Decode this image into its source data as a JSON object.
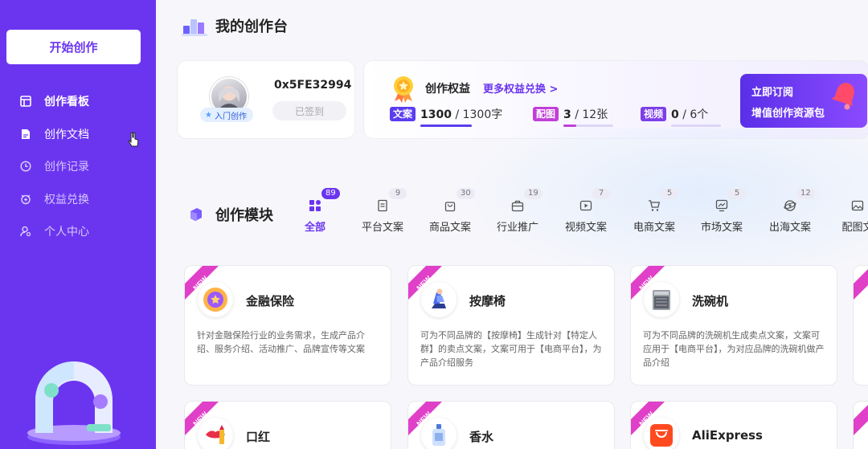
{
  "sidebar": {
    "start_button": "开始创作",
    "items": [
      {
        "label": "创作看板",
        "icon": "dashboard-icon",
        "active": true
      },
      {
        "label": "创作文档",
        "icon": "document-icon",
        "active": false
      },
      {
        "label": "创作记录",
        "icon": "clock-icon",
        "active": false
      },
      {
        "label": "权益兑换",
        "icon": "exchange-icon",
        "active": false
      },
      {
        "label": "个人中心",
        "icon": "user-icon",
        "active": false
      }
    ]
  },
  "header": {
    "title": "我的创作台"
  },
  "profile": {
    "user_id": "0x5FE32994",
    "level": "入门创作",
    "checkin": "已签到"
  },
  "benefits": {
    "title": "创作权益",
    "more": "更多权益兑换 >",
    "quotas": [
      {
        "tag": "文案",
        "used": "1300",
        "total": "/ 1300字",
        "fraction": 1.0
      },
      {
        "tag": "配图",
        "used": "3",
        "total": "/ 12张",
        "fraction": 0.25
      },
      {
        "tag": "视频",
        "used": "0",
        "total": "/ 6个",
        "fraction": 0.0
      }
    ],
    "subscribe_line1": "立即订阅",
    "subscribe_line2": "增值创作资源包"
  },
  "modules": {
    "title": "创作模块",
    "tabs": [
      {
        "label": "全部",
        "count": "89",
        "icon": "grid-icon",
        "active": true
      },
      {
        "label": "平台文案",
        "count": "9",
        "icon": "doc-icon"
      },
      {
        "label": "商品文案",
        "count": "30",
        "icon": "bag-icon"
      },
      {
        "label": "行业推广",
        "count": "19",
        "icon": "briefcase-icon"
      },
      {
        "label": "视频文案",
        "count": "7",
        "icon": "video-icon"
      },
      {
        "label": "电商文案",
        "count": "5",
        "icon": "cart-icon"
      },
      {
        "label": "市场文案",
        "count": "5",
        "icon": "chart-icon"
      },
      {
        "label": "出海文案",
        "count": "12",
        "icon": "globe-icon"
      },
      {
        "label": "配图文",
        "count": "",
        "icon": "image-icon"
      }
    ],
    "cards": [
      {
        "badge": "NEW",
        "title": "金融保险",
        "desc": "针对金融保险行业的业务需求，生成产品介绍、服务介绍、活动推广、品牌宣传等文案"
      },
      {
        "badge": "NEW",
        "title": "按摩椅",
        "desc": "可为不同品牌的【按摩椅】生成针对【特定人群】的卖点文案，文案可用于【电商平台】，为产品介绍服务"
      },
      {
        "badge": "NEW",
        "title": "洗碗机",
        "desc": "可为不同品牌的洗碗机生成卖点文案，文案可应用于【电商平台】，为对应品牌的洗碗机做产品介绍"
      },
      {
        "badge": "NEW",
        "title": "口红",
        "desc": ""
      },
      {
        "badge": "NEW",
        "title": "香水",
        "desc": ""
      },
      {
        "badge": "NEW",
        "title": "AliExpress",
        "desc": ""
      }
    ]
  },
  "colors": {
    "accent": "#6b35f0",
    "tag_copy": "#5a3df0",
    "tag_image": "#c13fd8",
    "tag_video": "#7d3fe8"
  }
}
